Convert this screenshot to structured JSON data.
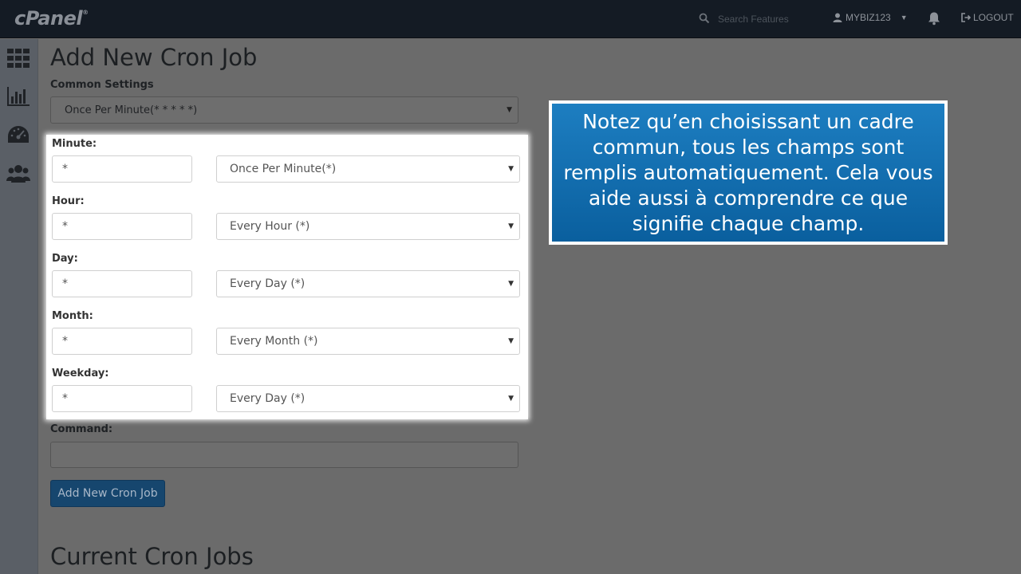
{
  "topbar": {
    "brand": "cPanel",
    "brand_mark": "®",
    "search_placeholder": "Search Features",
    "username": "MYBIZ123",
    "logout_label": "LOGOUT"
  },
  "sidebar": {
    "icons": [
      "grid-icon",
      "bar-chart-icon",
      "speedometer-icon",
      "users-icon"
    ]
  },
  "main": {
    "title": "Add New Cron Job",
    "common_settings_label": "Common Settings",
    "common_settings_value": "Once Per Minute(* * * * *)",
    "fields": [
      {
        "label": "Minute:",
        "value": "*",
        "select": "Once Per Minute(*)"
      },
      {
        "label": "Hour:",
        "value": "*",
        "select": "Every Hour (*)"
      },
      {
        "label": "Day:",
        "value": "*",
        "select": "Every Day (*)"
      },
      {
        "label": "Month:",
        "value": "*",
        "select": "Every Month (*)"
      },
      {
        "label": "Weekday:",
        "value": "*",
        "select": "Every Day (*)"
      }
    ],
    "command_label": "Command:",
    "command_value": "",
    "submit_label": "Add New Cron Job",
    "current_jobs_title": "Current Cron Jobs"
  },
  "callout": {
    "text": "Notez qu’en choisissant un cadre commun, tous les champs sont remplis automatiquement. Cela vous aide aussi à comprendre ce que signifie chaque champ."
  },
  "colors": {
    "topbar_bg": "#141b24",
    "overlay_bg": "#6b6b6b",
    "callout_blue": "#0a6aad",
    "button_blue": "#16466e"
  }
}
